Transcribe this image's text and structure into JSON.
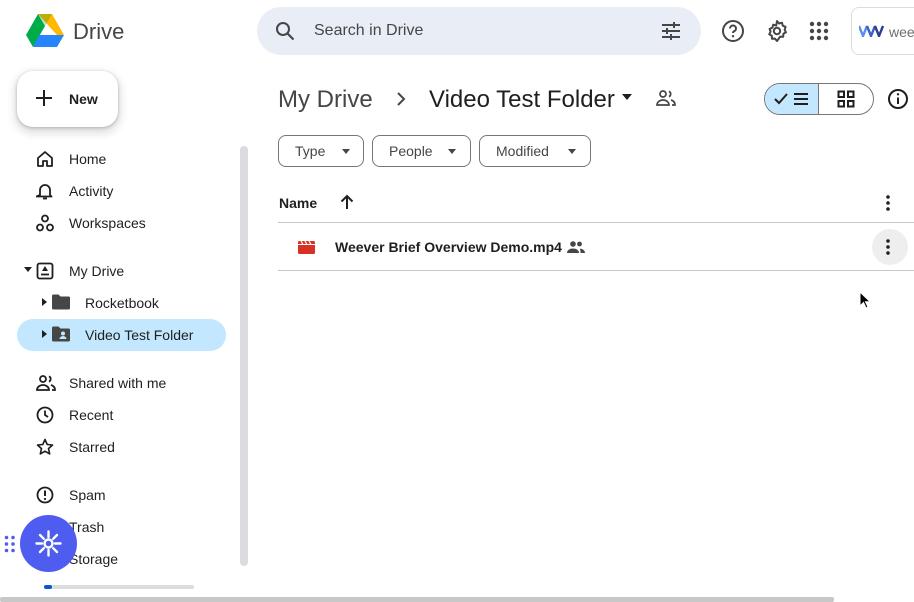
{
  "header": {
    "app_name": "Drive",
    "search_placeholder": "Search in Drive",
    "extension_label": "wee"
  },
  "new_button": {
    "label": "New"
  },
  "sidebar": {
    "items": [
      {
        "label": "Home",
        "icon": "home-icon"
      },
      {
        "label": "Activity",
        "icon": "bell-icon"
      },
      {
        "label": "Workspaces",
        "icon": "workspaces-icon"
      },
      {
        "label": "My Drive",
        "icon": "my-drive-icon"
      },
      {
        "label": "Rocketbook",
        "icon": "folder-icon"
      },
      {
        "label": "Video Test Folder",
        "icon": "shared-folder-icon",
        "selected": true
      },
      {
        "label": "Shared with me",
        "icon": "people-icon"
      },
      {
        "label": "Recent",
        "icon": "clock-icon"
      },
      {
        "label": "Starred",
        "icon": "star-icon"
      },
      {
        "label": "Spam",
        "icon": "spam-icon"
      },
      {
        "label": "Trash",
        "icon": "trash-icon"
      },
      {
        "label": "Storage",
        "icon": "cloud-icon"
      }
    ],
    "storage_used_fraction": 0.05
  },
  "breadcrumb": {
    "root": "My Drive",
    "current": "Video Test Folder"
  },
  "filters": [
    {
      "label": "Type"
    },
    {
      "label": "People"
    },
    {
      "label": "Modified"
    }
  ],
  "table": {
    "column_name": "Name",
    "sort": "ascending",
    "rows": [
      {
        "name": "Weever Brief Overview Demo.mp4",
        "type": "video",
        "shared": true
      }
    ]
  },
  "view": {
    "mode": "list"
  },
  "colors": {
    "accent": "#0b57d0",
    "selected_bg": "#c2e7ff",
    "search_bg": "#e9eef6",
    "video_icon": "#d93025",
    "fab": "#4f5cf0"
  }
}
